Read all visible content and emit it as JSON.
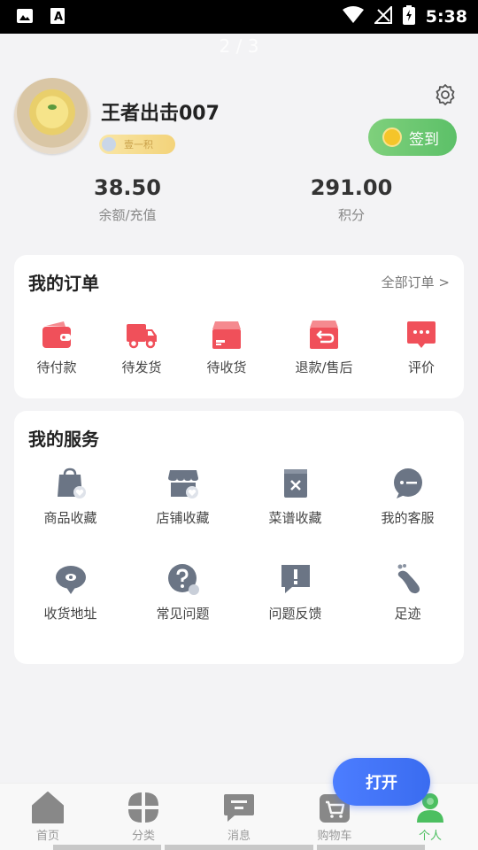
{
  "status_bar": {
    "time": "5:38"
  },
  "pager": "2 / 3",
  "profile": {
    "username": "王者出击007",
    "level_badge": "壹一积",
    "checkin_label": "签到"
  },
  "stats": [
    {
      "value": "38.50",
      "label": "余额/充值"
    },
    {
      "value": "291.00",
      "label": "积分"
    }
  ],
  "orders": {
    "title": "我的订单",
    "all_link": "全部订单 >",
    "items": [
      {
        "label": "待付款",
        "icon": "wallet-icon"
      },
      {
        "label": "待发货",
        "icon": "truck-icon"
      },
      {
        "label": "待收货",
        "icon": "box-icon"
      },
      {
        "label": "退款/售后",
        "icon": "refund-icon"
      },
      {
        "label": "评价",
        "icon": "comment-icon"
      }
    ]
  },
  "services": {
    "title": "我的服务",
    "items": [
      {
        "label": "商品收藏",
        "icon": "bag-heart-icon"
      },
      {
        "label": "店铺收藏",
        "icon": "store-heart-icon"
      },
      {
        "label": "菜谱收藏",
        "icon": "recipe-icon"
      },
      {
        "label": "我的客服",
        "icon": "chat-icon"
      },
      {
        "label": "收货地址",
        "icon": "location-icon"
      },
      {
        "label": "常见问题",
        "icon": "question-icon"
      },
      {
        "label": "问题反馈",
        "icon": "feedback-icon"
      },
      {
        "label": "足迹",
        "icon": "footprint-icon"
      }
    ]
  },
  "tabbar": [
    {
      "label": "首页",
      "icon": "home-icon"
    },
    {
      "label": "分类",
      "icon": "category-icon"
    },
    {
      "label": "消息",
      "icon": "message-icon"
    },
    {
      "label": "购物车",
      "icon": "cart-icon"
    },
    {
      "label": "个人",
      "icon": "profile-icon",
      "active": true
    }
  ],
  "open_button": "打开",
  "colors": {
    "accent_red": "#f0505a",
    "accent_green": "#5cc068",
    "service_icon": "#6b7585",
    "open_button": "#3a6cf0"
  }
}
